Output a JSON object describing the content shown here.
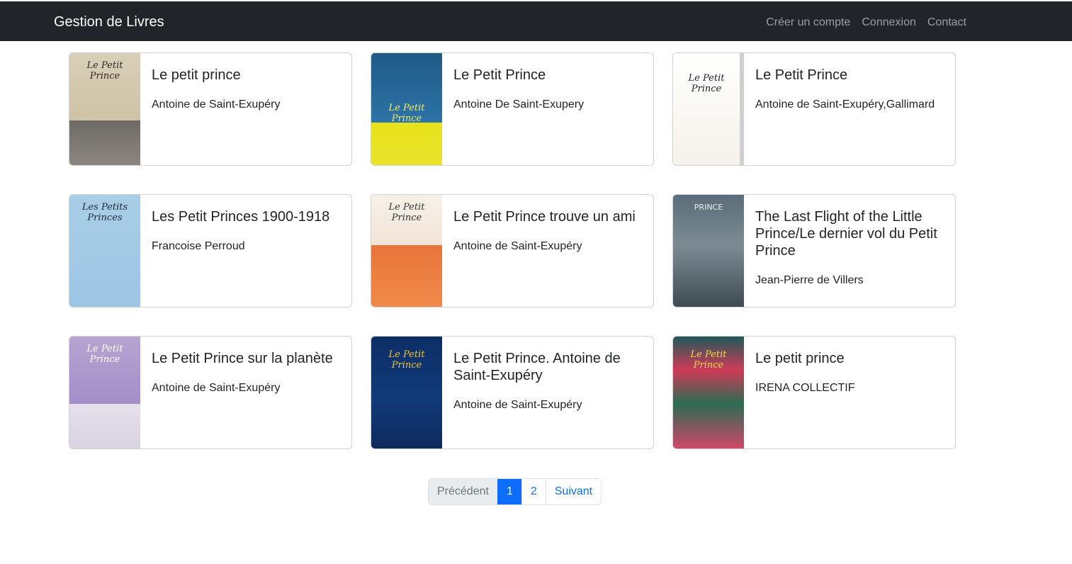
{
  "navbar": {
    "brand": "Gestion de Livres",
    "links": [
      "Créer un compte",
      "Connexion",
      "Contact"
    ]
  },
  "books": [
    {
      "title": "Le petit prince",
      "author": "Antoine de Saint-Exupéry",
      "cover_text": "Le Petit Prince"
    },
    {
      "title": "Le Petit Prince",
      "author": "Antoine De Saint-Exupery",
      "cover_text": "Le Petit Prince"
    },
    {
      "title": "Le Petit Prince",
      "author": "Antoine de Saint-Exupéry,Gallimard",
      "cover_text": "Le Petit Prince"
    },
    {
      "title": "Les Petit Princes 1900-1918",
      "author": "Francoise Perroud",
      "cover_text": "Les Petits Princes"
    },
    {
      "title": "Le Petit Prince trouve un ami",
      "author": "Antoine de Saint-Exupéry",
      "cover_text": "Le Petit Prince"
    },
    {
      "title": "The Last Flight of the Little Prince/Le dernier vol du Petit Prince",
      "author": "Jean-Pierre de Villers",
      "cover_text": "PRINCE"
    },
    {
      "title": "Le Petit Prince sur la planète",
      "author": "Antoine de Saint-Exupéry",
      "cover_text": "Le Petit Prince"
    },
    {
      "title": "Le Petit Prince. Antoine de Saint-Exupéry",
      "author": "Antoine de Saint-Exupéry",
      "cover_text": "Le Petit Prince"
    },
    {
      "title": "Le petit prince",
      "author": "IRENA COLLECTIF",
      "cover_text": "Le Petit Prince"
    }
  ],
  "pagination": {
    "previous": "Précédent",
    "pages": [
      "1",
      "2"
    ],
    "next": "Suivant"
  }
}
